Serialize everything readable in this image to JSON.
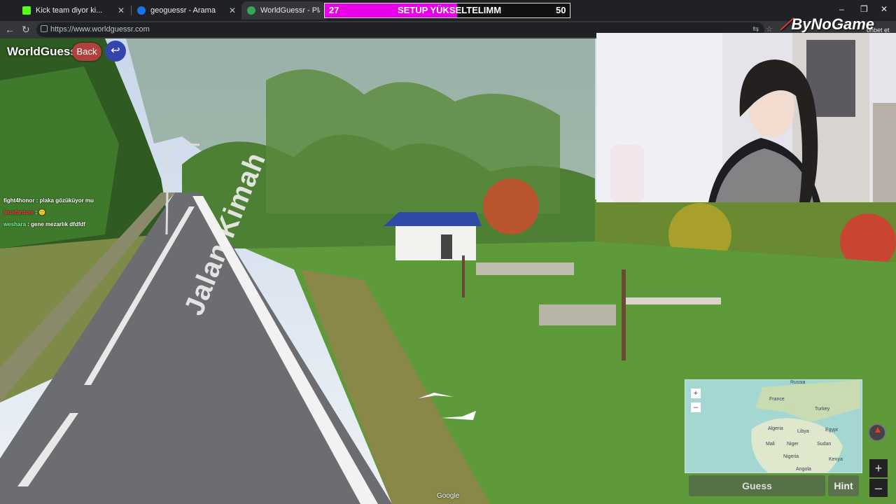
{
  "browser": {
    "tabs": [
      {
        "title": "Kick team diyor ki...",
        "color": "#53fc18"
      },
      {
        "title": "geoguessr - Arama",
        "color": "#1a73e8"
      },
      {
        "title": "WorldGuessr - Play Geoguessr",
        "color": "#34a853"
      }
    ],
    "url": "https://www.worldguessr.com",
    "window_controls": {
      "minimize": "–",
      "maximize": "❐",
      "close": "✕"
    }
  },
  "overlay": {
    "goal": {
      "current": "27",
      "label": "SETUP YÜKSELTELIMM",
      "target": "50",
      "progress": 0.54
    },
    "sponsor_brand": "ByNoGame",
    "sohbet": "ohbet et"
  },
  "game": {
    "logo": "WorldGuessr",
    "back_label": "Back",
    "undo_icon": "↩",
    "road_text": "Jalan Kimah",
    "guess_label": "Guess",
    "hint_label": "Hint",
    "zoom_in": "+",
    "zoom_out": "–",
    "minimap_labels": [
      "Russia",
      "France",
      "Turkey",
      "Algeria",
      "Libya",
      "Egypt",
      "Mali",
      "Niger",
      "Sudan",
      "Nigeria",
      "Kenya",
      "Angola"
    ],
    "watermark": "Google"
  },
  "chat": [
    {
      "user": "fight4honor",
      "message": "plaka gözüküyor mu"
    },
    {
      "user": "leonfantom",
      "message": "🙂"
    },
    {
      "user": "weshara",
      "message": "gene mezarlık dfdfdf"
    }
  ]
}
